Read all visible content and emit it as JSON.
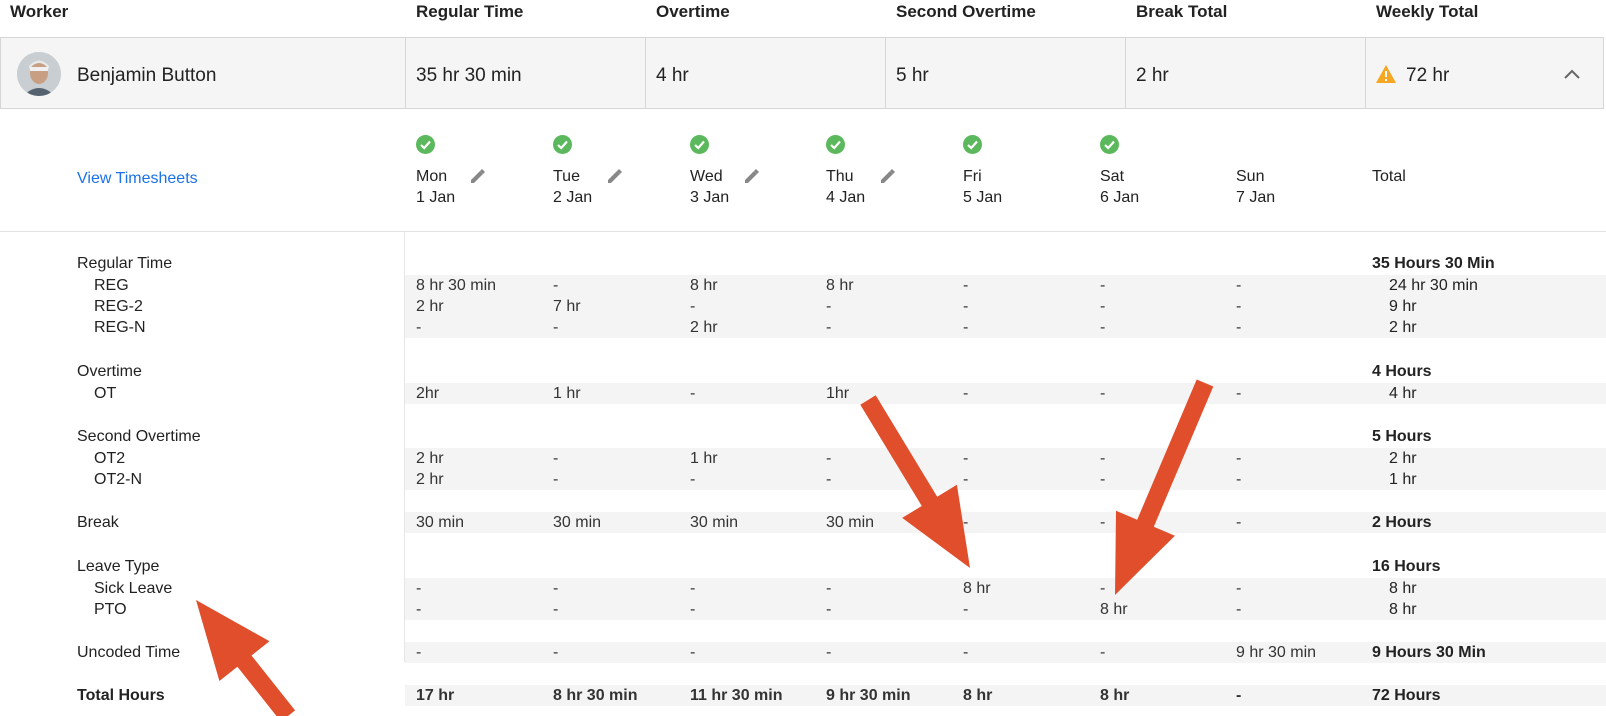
{
  "columns": {
    "worker": "Worker",
    "regular_time": "Regular Time",
    "overtime": "Overtime",
    "second_overtime": "Second Overtime",
    "break_total": "Break Total",
    "weekly_total": "Weekly Total"
  },
  "worker": {
    "name": "Benjamin Button",
    "regular_time": "35 hr 30 min",
    "overtime": "4 hr",
    "second_overtime": "5 hr",
    "break_total": "2 hr",
    "weekly_total": "72 hr",
    "warning_icon": "warning-triangle-icon",
    "collapse_icon": "chevron-up-icon"
  },
  "view_timesheets": "View Timesheets",
  "days": [
    {
      "day": "Mon",
      "date": "1 Jan",
      "approved": true,
      "editable": true
    },
    {
      "day": "Tue",
      "date": "2 Jan",
      "approved": true,
      "editable": true
    },
    {
      "day": "Wed",
      "date": "3 Jan",
      "approved": true,
      "editable": true
    },
    {
      "day": "Thu",
      "date": "4 Jan",
      "approved": true,
      "editable": true
    },
    {
      "day": "Fri",
      "date": "5 Jan",
      "approved": true,
      "editable": false
    },
    {
      "day": "Sat",
      "date": "6 Jan",
      "approved": true,
      "editable": false
    },
    {
      "day": "Sun",
      "date": "7 Jan",
      "approved": false,
      "editable": false
    }
  ],
  "total_label": "Total",
  "groups": {
    "regular": {
      "label": "Regular Time",
      "total": "35 Hours 30 Min"
    },
    "overtime": {
      "label": "Overtime",
      "total": "4 Hours"
    },
    "second_overtime": {
      "label": "Second Overtime",
      "total": "5 Hours"
    },
    "break": {
      "label": "Break",
      "values": [
        "30 min",
        "30 min",
        "30 min",
        "30 min",
        "-",
        "-",
        "-"
      ],
      "total": "2 Hours"
    },
    "leave": {
      "label": "Leave Type",
      "total": "16 Hours"
    },
    "uncoded": {
      "label": "Uncoded Time",
      "values": [
        "-",
        "-",
        "-",
        "-",
        "-",
        "-",
        "9 hr 30 min"
      ],
      "total": "9 Hours 30 Min"
    },
    "total_hours": {
      "label": "Total Hours",
      "values": [
        "17 hr",
        "8 hr 30 min",
        "11 hr 30 min",
        "9 hr 30 min",
        "8 hr",
        "8 hr",
        "-"
      ],
      "total": "72 Hours"
    }
  },
  "rows": {
    "reg": {
      "label": "REG",
      "values": [
        "8 hr 30 min",
        "-",
        "8 hr",
        "8 hr",
        "-",
        "-",
        "-"
      ],
      "total": "24 hr 30 min"
    },
    "reg2": {
      "label": "REG-2",
      "values": [
        "2 hr",
        "7 hr",
        "-",
        "-",
        "-",
        "-",
        "-"
      ],
      "total": "9 hr"
    },
    "regn": {
      "label": "REG-N",
      "values": [
        "-",
        "-",
        "2 hr",
        "-",
        "-",
        "-",
        "-"
      ],
      "total": "2 hr"
    },
    "ot": {
      "label": "OT",
      "values": [
        "2hr",
        "1 hr",
        "-",
        "1hr",
        "-",
        "-",
        "-"
      ],
      "total": "4 hr"
    },
    "ot2": {
      "label": "OT2",
      "values": [
        "2 hr",
        "-",
        "1 hr",
        "-",
        "-",
        "-",
        "-"
      ],
      "total": "2 hr"
    },
    "ot2n": {
      "label": "OT2-N",
      "values": [
        "2 hr",
        "-",
        "-",
        "-",
        "-",
        "-",
        "-"
      ],
      "total": "1 hr"
    },
    "sick": {
      "label": "Sick Leave",
      "values": [
        "-",
        "-",
        "-",
        "-",
        "8 hr",
        "-",
        "-"
      ],
      "total": "8 hr"
    },
    "pto": {
      "label": "PTO",
      "values": [
        "-",
        "-",
        "-",
        "-",
        "-",
        "8 hr",
        "-"
      ],
      "total": "8 hr"
    }
  },
  "annotation_color": "#e04e2b"
}
